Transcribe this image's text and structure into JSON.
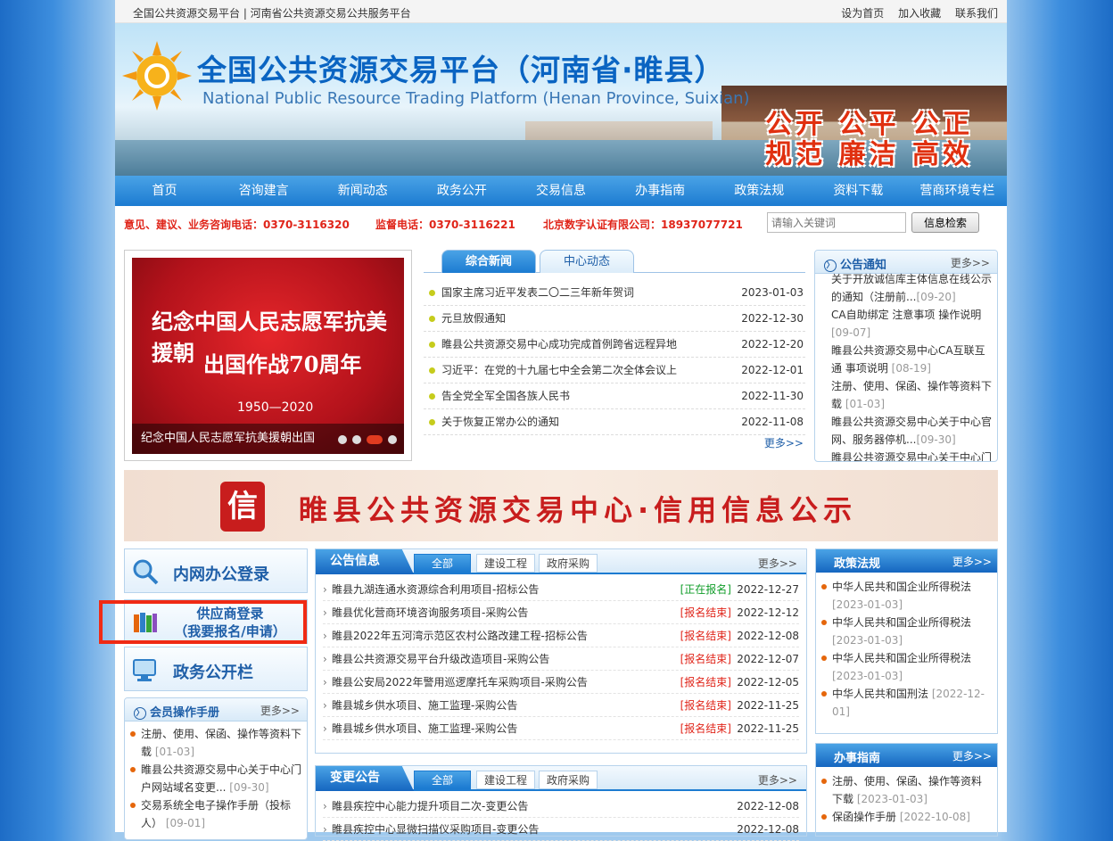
{
  "topbar": {
    "left": "全国公共资源交易平台 | 河南省公共资源交易公共服务平台",
    "links": [
      "设为首页",
      "加入收藏",
      "联系我们"
    ]
  },
  "banner": {
    "title": "全国公共资源交易平台（河南省·睢县）",
    "subtitle": "National Public Resource Trading Platform (Henan Province, Suixian)",
    "slogan_line1": "公开 公平 公正",
    "slogan_line2": "规范 廉洁 高效"
  },
  "nav": [
    "首页",
    "咨询建言",
    "新闻动态",
    "政务公开",
    "交易信息",
    "办事指南",
    "政策法规",
    "资料下载",
    "营商环境专栏"
  ],
  "contact": {
    "consult": "意见、建议、业务咨询电话：0370-3116320",
    "supervise": "监督电话：0370-3116221",
    "ca": "北京数字认证有限公司：18937077721",
    "search_placeholder": "请输入关键词",
    "search_button": "信息检索"
  },
  "slider": {
    "line1": "纪念中国人民志愿军抗美援朝",
    "line2": "出国作战70周年",
    "line3": "1950—2020",
    "caption": "纪念中国人民志愿军抗美援朝出国"
  },
  "news": {
    "tab_active": "综合新闻",
    "tab_other": "中心动态",
    "items": [
      {
        "title": "国家主席习近平发表二〇二三年新年贺词",
        "date": "2023-01-03"
      },
      {
        "title": "元旦放假通知",
        "date": "2022-12-30"
      },
      {
        "title": "睢县公共资源交易中心成功完成首例跨省远程异地",
        "date": "2022-12-20"
      },
      {
        "title": "习近平：在党的十九届七中全会第二次全体会议上",
        "date": "2022-12-01"
      },
      {
        "title": "告全党全军全国各族人民书",
        "date": "2022-11-30"
      },
      {
        "title": "关于恢复正常办公的通知",
        "date": "2022-11-08"
      }
    ],
    "more": "更多>>"
  },
  "notice": {
    "title": "公告通知",
    "more": "更多>>",
    "items": [
      {
        "text": "关于开放诚信库主体信息在线公示的通知（注册前...",
        "date": "[09-20]"
      },
      {
        "text": "CA自助绑定 注意事项 操作说明",
        "date": "[09-07]"
      },
      {
        "text": "睢县公共资源交易中心CA互联互通 事项说明",
        "date": "[08-19]"
      },
      {
        "text": "注册、使用、保函、操作等资料下载",
        "date": "[01-03]"
      },
      {
        "text": "睢县公共资源交易中心关于中心官网、服务器停机...",
        "date": "[09-30]"
      },
      {
        "text": "睢县公共资源交易中心关于中心门",
        "date": ""
      }
    ]
  },
  "credit": {
    "seal": "信",
    "text": "睢县公共资源交易中心·信用信息公示"
  },
  "shortcuts": {
    "intranet": "内网办公登录",
    "supplier_l1": "供应商登录",
    "supplier_l2": "（我要报名/申请）",
    "gov": "政务公开栏"
  },
  "manual": {
    "title": "会员操作手册",
    "more": "更多>>",
    "items": [
      {
        "text": "注册、使用、保函、操作等资料下载",
        "date": "[01-03]"
      },
      {
        "text": "睢县公共资源交易中心关于中心门户网站域名变更...",
        "date": "[09-30]"
      },
      {
        "text": "交易系统全电子操作手册（投标人）",
        "date": "[09-01]"
      }
    ]
  },
  "announce": {
    "title": "公告信息",
    "tabs": [
      "全部",
      "建设工程",
      "政府采购"
    ],
    "more": "更多>>",
    "items": [
      {
        "title": "睢县九湖连通水资源综合利用项目-招标公告",
        "status": "[正在报名]",
        "date": "2022-12-27"
      },
      {
        "title": "睢县优化营商环境咨询服务项目-采购公告",
        "status": "[报名结束]",
        "date": "2022-12-12"
      },
      {
        "title": "睢县2022年五河湾示范区农村公路改建工程-招标公告",
        "status": "[报名结束]",
        "date": "2022-12-08"
      },
      {
        "title": "睢县公共资源交易平台升级改造项目-采购公告",
        "status": "[报名结束]",
        "date": "2022-12-07"
      },
      {
        "title": "睢县公安局2022年警用巡逻摩托车采购项目-采购公告",
        "status": "[报名结束]",
        "date": "2022-12-05"
      },
      {
        "title": "睢县城乡供水项目、施工监理-采购公告",
        "status": "[报名结束]",
        "date": "2022-11-25"
      },
      {
        "title": "睢县城乡供水项目、施工监理-采购公告",
        "status": "[报名结束]",
        "date": "2022-11-25"
      }
    ]
  },
  "change": {
    "title": "变更公告",
    "tabs": [
      "全部",
      "建设工程",
      "政府采购"
    ],
    "more": "更多>>",
    "items": [
      {
        "title": "睢县疾控中心能力提升项目二次-变更公告",
        "date": "2022-12-08"
      },
      {
        "title": "睢县疾控中心显微扫描仪采购项目-变更公告",
        "date": "2022-12-08"
      }
    ]
  },
  "policy": {
    "title": "政策法规",
    "more": "更多>>",
    "items": [
      {
        "text": "中华人民共和国企业所得税法",
        "date": "[2023-01-03]"
      },
      {
        "text": "中华人民共和国企业所得税法",
        "date": "[2023-01-03]"
      },
      {
        "text": "中华人民共和国企业所得税法",
        "date": "[2023-01-03]"
      },
      {
        "text": "中华人民共和国刑法",
        "date": "[2022-12-01]"
      }
    ]
  },
  "guide": {
    "title": "办事指南",
    "more": "更多>>",
    "items": [
      {
        "text": "注册、使用、保函、操作等资料下载",
        "date": "[2023-01-03]"
      },
      {
        "text": "保函操作手册",
        "date": "[2022-10-08]"
      }
    ]
  }
}
